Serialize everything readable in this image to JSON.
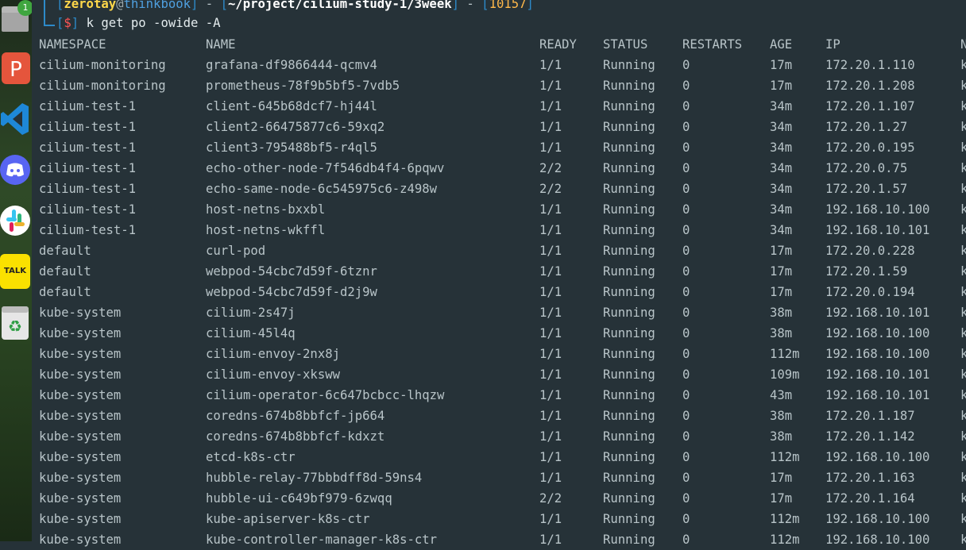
{
  "dock": {
    "badge": "1",
    "items": [
      {
        "name": "files-icon"
      },
      {
        "name": "wps-presentation-icon",
        "glyph": "P"
      },
      {
        "name": "vscode-icon"
      },
      {
        "name": "discord-icon"
      },
      {
        "name": "slack-icon"
      },
      {
        "name": "kakaotalk-icon",
        "label": "TALK"
      },
      {
        "name": "trash-icon",
        "glyph": "♻"
      }
    ]
  },
  "prompt": {
    "user": "zerotay",
    "at": "@",
    "host": "thinkbook",
    "path": "~/project/cilium-study-1/3week",
    "timestamp": "10157",
    "dollar": "$",
    "command": "k get po -owide -A"
  },
  "table": {
    "columns": [
      "NAMESPACE",
      "NAME",
      "READY",
      "STATUS",
      "RESTARTS",
      "AGE",
      "IP",
      "N"
    ],
    "rows": [
      [
        "cilium-monitoring",
        "grafana-df9866444-qcmv4",
        "1/1",
        "Running",
        "0",
        "17m",
        "172.20.1.110",
        "k"
      ],
      [
        "cilium-monitoring",
        "prometheus-78f9b5bf5-7vdb5",
        "1/1",
        "Running",
        "0",
        "17m",
        "172.20.1.208",
        "k"
      ],
      [
        "cilium-test-1",
        "client-645b68dcf7-hj44l",
        "1/1",
        "Running",
        "0",
        "34m",
        "172.20.1.107",
        "k"
      ],
      [
        "cilium-test-1",
        "client2-66475877c6-59xq2",
        "1/1",
        "Running",
        "0",
        "34m",
        "172.20.1.27",
        "k"
      ],
      [
        "cilium-test-1",
        "client3-795488bf5-r4ql5",
        "1/1",
        "Running",
        "0",
        "34m",
        "172.20.0.195",
        "k"
      ],
      [
        "cilium-test-1",
        "echo-other-node-7f546db4f4-6pqwv",
        "2/2",
        "Running",
        "0",
        "34m",
        "172.20.0.75",
        "k"
      ],
      [
        "cilium-test-1",
        "echo-same-node-6c545975c6-z498w",
        "2/2",
        "Running",
        "0",
        "34m",
        "172.20.1.57",
        "k"
      ],
      [
        "cilium-test-1",
        "host-netns-bxxbl",
        "1/1",
        "Running",
        "0",
        "34m",
        "192.168.10.100",
        "k"
      ],
      [
        "cilium-test-1",
        "host-netns-wkffl",
        "1/1",
        "Running",
        "0",
        "34m",
        "192.168.10.101",
        "k"
      ],
      [
        "default",
        "curl-pod",
        "1/1",
        "Running",
        "0",
        "17m",
        "172.20.0.228",
        "k"
      ],
      [
        "default",
        "webpod-54cbc7d59f-6tznr",
        "1/1",
        "Running",
        "0",
        "17m",
        "172.20.1.59",
        "k"
      ],
      [
        "default",
        "webpod-54cbc7d59f-d2j9w",
        "1/1",
        "Running",
        "0",
        "17m",
        "172.20.0.194",
        "k"
      ],
      [
        "kube-system",
        "cilium-2s47j",
        "1/1",
        "Running",
        "0",
        "38m",
        "192.168.10.101",
        "k"
      ],
      [
        "kube-system",
        "cilium-45l4q",
        "1/1",
        "Running",
        "0",
        "38m",
        "192.168.10.100",
        "k"
      ],
      [
        "kube-system",
        "cilium-envoy-2nx8j",
        "1/1",
        "Running",
        "0",
        "112m",
        "192.168.10.100",
        "k"
      ],
      [
        "kube-system",
        "cilium-envoy-xksww",
        "1/1",
        "Running",
        "0",
        "109m",
        "192.168.10.101",
        "k"
      ],
      [
        "kube-system",
        "cilium-operator-6c647bcbcc-lhqzw",
        "1/1",
        "Running",
        "0",
        "43m",
        "192.168.10.101",
        "k"
      ],
      [
        "kube-system",
        "coredns-674b8bbfcf-jp664",
        "1/1",
        "Running",
        "0",
        "38m",
        "172.20.1.187",
        "k"
      ],
      [
        "kube-system",
        "coredns-674b8bbfcf-kdxzt",
        "1/1",
        "Running",
        "0",
        "38m",
        "172.20.1.142",
        "k"
      ],
      [
        "kube-system",
        "etcd-k8s-ctr",
        "1/1",
        "Running",
        "0",
        "112m",
        "192.168.10.100",
        "k"
      ],
      [
        "kube-system",
        "hubble-relay-77bbbdff8d-59ns4",
        "1/1",
        "Running",
        "0",
        "17m",
        "172.20.1.163",
        "k"
      ],
      [
        "kube-system",
        "hubble-ui-c649bf979-6zwqq",
        "2/2",
        "Running",
        "0",
        "17m",
        "172.20.1.164",
        "k"
      ],
      [
        "kube-system",
        "kube-apiserver-k8s-ctr",
        "1/1",
        "Running",
        "0",
        "112m",
        "192.168.10.100",
        "k"
      ],
      [
        "kube-system",
        "kube-controller-manager-k8s-ctr",
        "1/1",
        "Running",
        "0",
        "112m",
        "192.168.10.100",
        "k"
      ]
    ]
  }
}
